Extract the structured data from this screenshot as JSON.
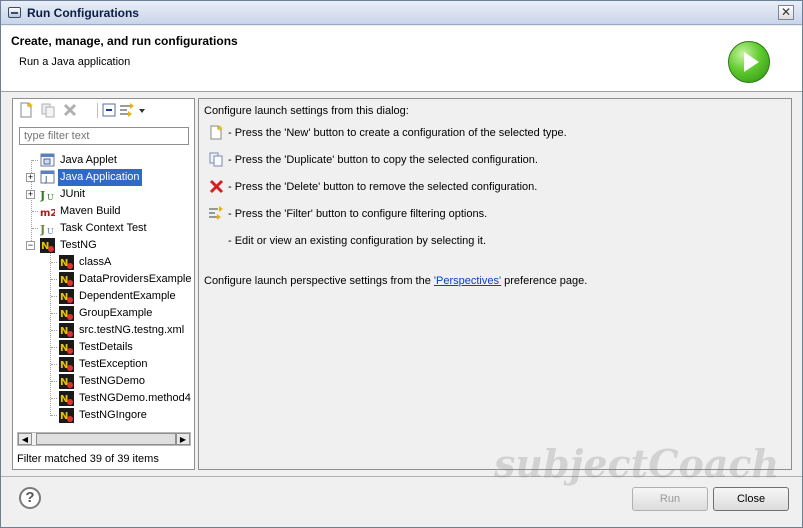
{
  "window": {
    "title": "Run Configurations"
  },
  "header": {
    "title": "Create, manage, and run configurations",
    "subtitle": "Run a Java application"
  },
  "left": {
    "filter_placeholder": "type filter text",
    "tree": [
      {
        "label": "Java Applet",
        "icon": "java-applet-icon"
      },
      {
        "label": "Java Application",
        "icon": "java-application-icon",
        "selected": true
      },
      {
        "label": "JUnit",
        "icon": "junit-icon"
      },
      {
        "label": "Maven Build",
        "icon": "maven-icon"
      },
      {
        "label": "Task Context Test",
        "icon": "task-context-icon"
      },
      {
        "label": "TestNG",
        "icon": "testng-icon",
        "children": [
          "classA",
          "DataProvidersExample",
          "DependentExample",
          "GroupExample",
          "src.testNG.testng.xml",
          "TestDetails",
          "TestException",
          "TestNGDemo",
          "TestNGDemo.method4",
          "TestNGIngore"
        ]
      }
    ],
    "expander_plus": "+",
    "expander_minus": "−",
    "status": "Filter matched 39 of 39 items"
  },
  "right": {
    "intro": "Configure launch settings from this dialog:",
    "items": [
      "- Press the 'New' button to create a configuration of the selected type.",
      "- Press the 'Duplicate' button to copy the selected configuration.",
      "- Press the 'Delete' button to remove the selected configuration.",
      "- Press the 'Filter' button to configure filtering options.",
      "- Edit or view an existing configuration by selecting it."
    ],
    "perspective_before": "Configure launch perspective settings from the ",
    "perspective_link": "'Perspectives'",
    "perspective_after": " preference page."
  },
  "footer": {
    "help": "?",
    "run": "Run",
    "close": "Close"
  },
  "watermark": "subjectCoach"
}
